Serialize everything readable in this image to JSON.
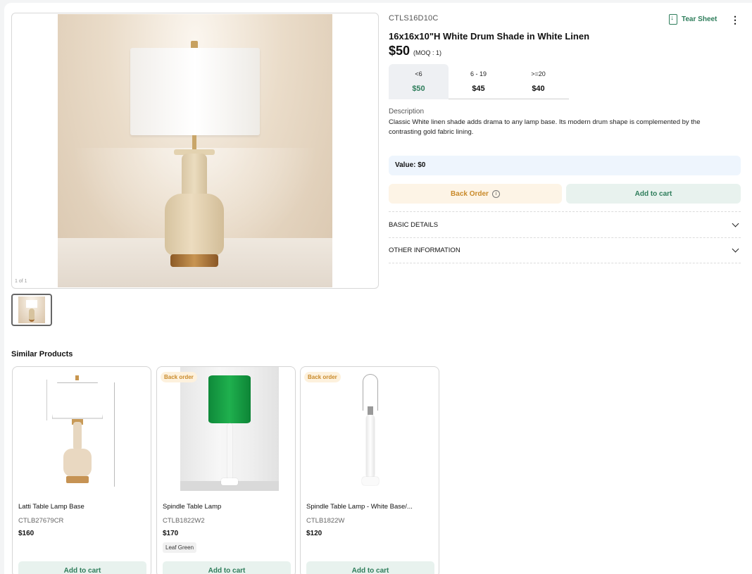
{
  "product": {
    "sku": "CTLS16D10C",
    "title": "16x16x10\"H White Drum Shade in White Linen",
    "price": "$50",
    "moq": "(MOQ : 1)",
    "image_counter": "1 of 1",
    "tear_sheet_label": "Tear Sheet",
    "more_icon": "⋮",
    "tiers": [
      {
        "range": "<6",
        "price": "$50"
      },
      {
        "range": "6 - 19",
        "price": "$45"
      },
      {
        "range": ">=20",
        "price": "$40"
      }
    ],
    "description_label": "Description",
    "description": "Classic White linen shade adds drama to any lamp base. Its modern drum shape is complemented by the contrasting gold fabric lining.",
    "value_label": "Value: $0",
    "back_order_label": "Back Order",
    "info_icon": "i",
    "add_to_cart_label": "Add to cart",
    "accordions": [
      {
        "label": "BASIC DETAILS"
      },
      {
        "label": "OTHER INFORMATION"
      }
    ]
  },
  "similar": {
    "title": "Similar Products",
    "items": [
      {
        "name": "Latti Table Lamp Base",
        "code": "CTLB27679CR",
        "price": "$160",
        "badge": "",
        "tag": "",
        "cart_label": "Add to cart"
      },
      {
        "name": "Spindle Table Lamp",
        "code": "CTLB1822W2",
        "price": "$170",
        "badge": "Back order",
        "tag": "Leaf Green",
        "cart_label": "Add to cart"
      },
      {
        "name": "Spindle Table Lamp - White Base/...",
        "code": "CTLB1822W",
        "price": "$120",
        "badge": "Back order",
        "tag": "",
        "cart_label": "Add to cart"
      }
    ]
  },
  "colors": {
    "accent_green": "#2e7d5b",
    "back_order_orange": "#c98a2a"
  }
}
